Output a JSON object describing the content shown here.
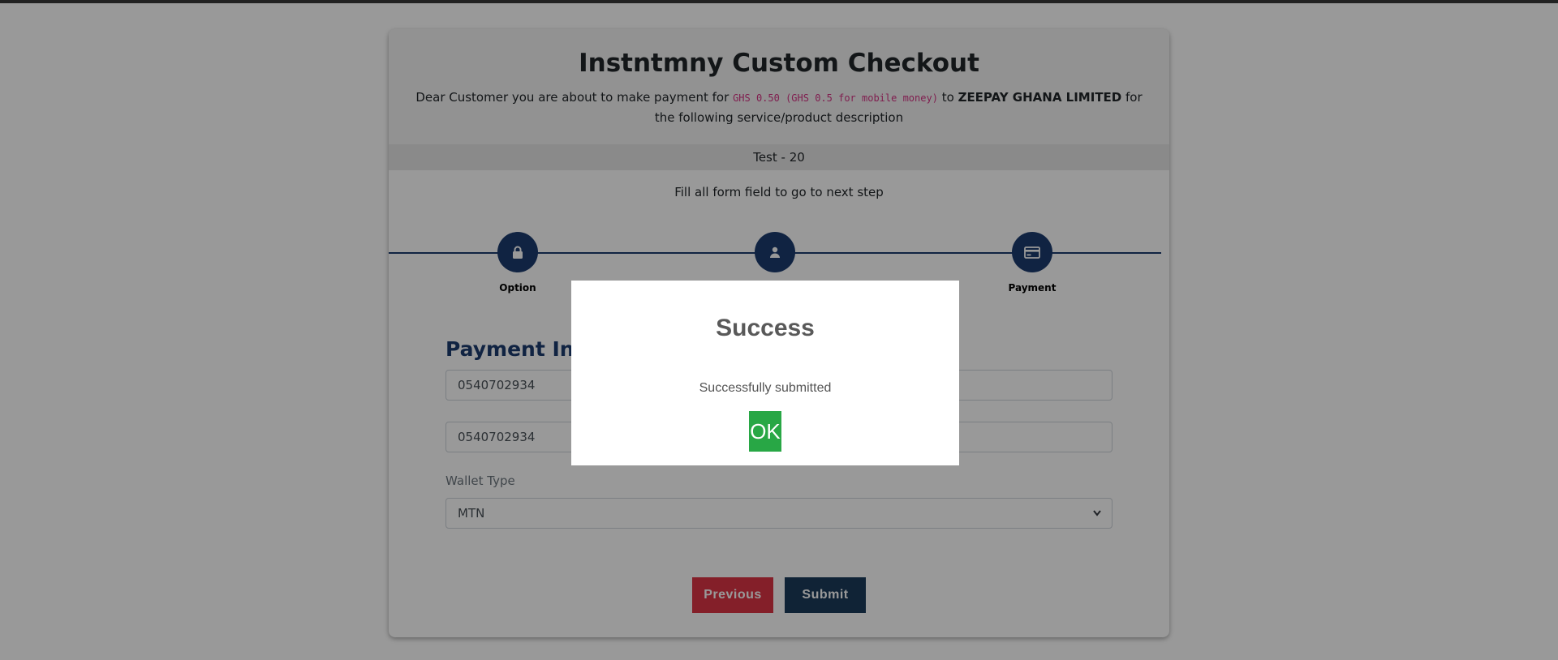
{
  "checkout": {
    "title": "Instntmny Custom Checkout",
    "desc_prefix": "Dear Customer you are about to make payment for",
    "amount": "GHS 0.50 (GHS 0.5 for mobile money)",
    "desc_to": "to",
    "merchant": "ZEEPAY GHANA LIMITED",
    "desc_suffix": "for the following service/product description",
    "service": "Test - 20",
    "hint": "Fill all form field to go to next step"
  },
  "steps": [
    {
      "label": "Option",
      "icon": "lock-icon"
    },
    {
      "label": "",
      "icon": "user-icon"
    },
    {
      "label": "Payment",
      "icon": "credit-card-icon"
    }
  ],
  "form": {
    "section_title": "Payment Info",
    "phone_value": "0540702934",
    "confirm_phone_value": "0540702934",
    "wallet_label": "Wallet Type",
    "wallet_value": "MTN"
  },
  "buttons": {
    "previous": "Previous",
    "submit": "Submit"
  },
  "modal": {
    "title": "Success",
    "message": "Successfully submitted",
    "ok": "OK"
  },
  "colors": {
    "primary": "#1c3b6e",
    "danger": "#dc3545",
    "success": "#28a745"
  }
}
